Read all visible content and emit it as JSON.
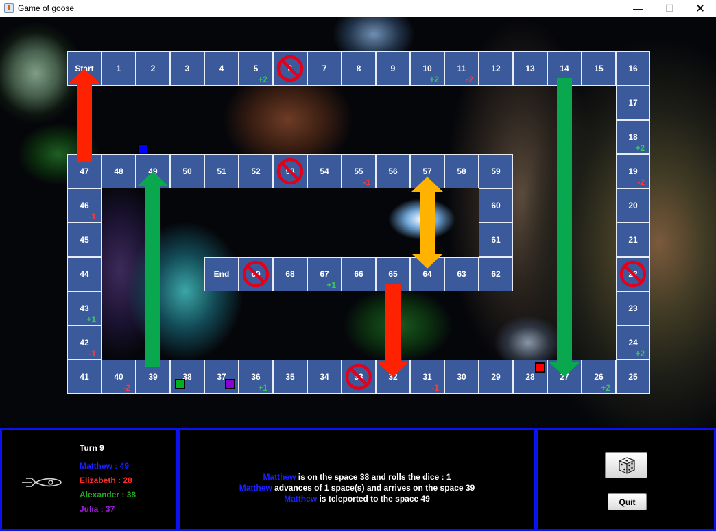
{
  "window": {
    "title": "Game of goose",
    "minimize_glyph": "—",
    "maximize_glyph": "☐",
    "close_glyph": "✕"
  },
  "board": {
    "cells": [
      {
        "label": "Start"
      },
      {
        "label": "1"
      },
      {
        "label": "2"
      },
      {
        "label": "3"
      },
      {
        "label": "4"
      },
      {
        "label": "5",
        "mod": "+2"
      },
      {
        "label": "6",
        "blocked": true
      },
      {
        "label": "7"
      },
      {
        "label": "8"
      },
      {
        "label": "9"
      },
      {
        "label": "10",
        "mod": "+2"
      },
      {
        "label": "11",
        "mod": "-2"
      },
      {
        "label": "12"
      },
      {
        "label": "13"
      },
      {
        "label": "14"
      },
      {
        "label": "15"
      },
      {
        "label": "16"
      },
      {
        "label": "17"
      },
      {
        "label": "18",
        "mod": "+2"
      },
      {
        "label": "19",
        "mod": "-2"
      },
      {
        "label": "20"
      },
      {
        "label": "21"
      },
      {
        "label": "22",
        "blocked": true
      },
      {
        "label": "23"
      },
      {
        "label": "24",
        "mod": "+2"
      },
      {
        "label": "25"
      },
      {
        "label": "26",
        "mod": "+2"
      },
      {
        "label": "27"
      },
      {
        "label": "28"
      },
      {
        "label": "29"
      },
      {
        "label": "30"
      },
      {
        "label": "31",
        "mod": "-1"
      },
      {
        "label": "32"
      },
      {
        "label": "33",
        "blocked": true
      },
      {
        "label": "34"
      },
      {
        "label": "35"
      },
      {
        "label": "36",
        "mod": "+1"
      },
      {
        "label": "37"
      },
      {
        "label": "38"
      },
      {
        "label": "39"
      },
      {
        "label": "40",
        "mod": "-2"
      },
      {
        "label": "41"
      },
      {
        "label": "42",
        "mod": "-1"
      },
      {
        "label": "43",
        "mod": "+1"
      },
      {
        "label": "44"
      },
      {
        "label": "45"
      },
      {
        "label": "46",
        "mod": "-1"
      },
      {
        "label": "47"
      },
      {
        "label": "48"
      },
      {
        "label": "49"
      },
      {
        "label": "50"
      },
      {
        "label": "51"
      },
      {
        "label": "52"
      },
      {
        "label": "53",
        "blocked": true
      },
      {
        "label": "54"
      },
      {
        "label": "55",
        "mod": "-1"
      },
      {
        "label": "56"
      },
      {
        "label": "57"
      },
      {
        "label": "58"
      },
      {
        "label": "59"
      },
      {
        "label": "60"
      },
      {
        "label": "61"
      },
      {
        "label": "62"
      },
      {
        "label": "63"
      },
      {
        "label": "64"
      },
      {
        "label": "65"
      },
      {
        "label": "66"
      },
      {
        "label": "67",
        "mod": "+1"
      },
      {
        "label": "68"
      },
      {
        "label": "69",
        "blocked": true
      },
      {
        "label": "End"
      }
    ],
    "arrows": [
      {
        "from": "47",
        "to": "Start",
        "color": "#ff2200"
      },
      {
        "from": "39",
        "to": "49",
        "color": "#0aa84e"
      },
      {
        "from": "14",
        "to": "27",
        "color": "#0aa84e"
      },
      {
        "from": "65",
        "to": "32",
        "color": "#ff2200"
      },
      {
        "from": "57",
        "to": "64",
        "color": "#ffb300",
        "double": true
      }
    ],
    "pawns": [
      {
        "player": "Matthew",
        "space": "49",
        "color": "#0000ff"
      },
      {
        "player": "Elizabeth",
        "space": "28",
        "color": "#ff0000"
      },
      {
        "player": "Alexander",
        "space": "38",
        "color": "#00b020"
      },
      {
        "player": "Julia",
        "space": "37",
        "color": "#8a00d4"
      }
    ]
  },
  "status": {
    "turn": "Turn 9",
    "players": [
      {
        "text": "Matthew : 49",
        "color": "#1a20ff"
      },
      {
        "text": "Elizabeth : 28",
        "color": "#ff2b2b"
      },
      {
        "text": "Alexander : 38",
        "color": "#22aa22"
      },
      {
        "text": "Julia : 37",
        "color": "#9a1fd6"
      }
    ]
  },
  "log": [
    {
      "name": "Matthew",
      "text": " is on the space 38 and rolls the dice : 1"
    },
    {
      "name": "Matthew",
      "text": " advances of 1 space(s) and arrives on the space 39"
    },
    {
      "name": "Matthew",
      "text": " is teleported to the space 49"
    }
  ],
  "controls": {
    "dice_icon": "dice-icon",
    "quit_label": "Quit"
  },
  "colors": {
    "cell_fill": "#3b5a9b",
    "panel_border": "#0a12f0",
    "log_name": "#1a20ff"
  }
}
